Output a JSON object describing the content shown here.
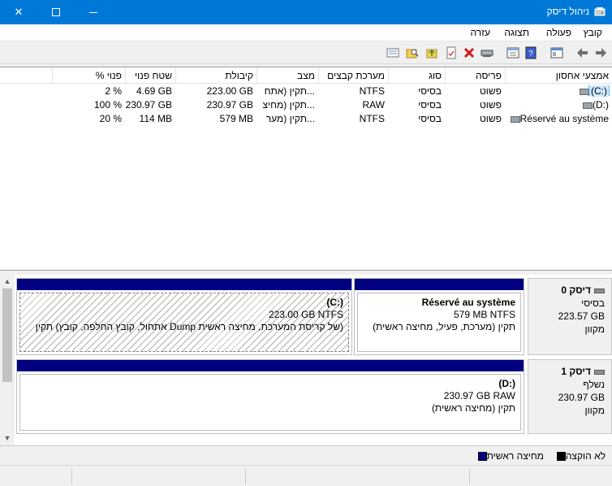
{
  "window": {
    "title": "ניהול דיסק",
    "close_glyph": "✕"
  },
  "menu": [
    "קובץ",
    "פעולה",
    "תצוגה",
    "עזרה"
  ],
  "volumes": {
    "columns": [
      "אמצעי אחסון",
      "פריסה",
      "סוג",
      "מערכת קבצים",
      "מצב",
      "קיבולת",
      "שטח פנוי",
      "% פנוי"
    ],
    "rows": [
      {
        "volume": "(C:)",
        "layout": "פשוט",
        "type": "בסיסי",
        "fs": "NTFS",
        "status": "תקין (אתח...",
        "capacity": "223.00 GB",
        "free": "4.69 GB",
        "pct": "2 %"
      },
      {
        "volume": "(D:)",
        "layout": "פשוט",
        "type": "בסיסי",
        "fs": "RAW",
        "status": "תקין (מחיצ...",
        "capacity": "230.97 GB",
        "free": "230.97 GB",
        "pct": "100 %"
      },
      {
        "volume": "Réservé au système",
        "layout": "פשוט",
        "type": "בסיסי",
        "fs": "NTFS",
        "status": "תקין (מער...",
        "capacity": "579 MB",
        "free": "114 MB",
        "pct": "20 %"
      }
    ]
  },
  "disks": [
    {
      "name": "דיסק 0",
      "type": "בסיסי",
      "size": "223.57 GB",
      "state": "מקוון",
      "partitions": [
        {
          "title": "Réservé au système",
          "detail": "579 MB NTFS",
          "status": "תקין (מערכת, פעיל, מחיצה ראשית)"
        },
        {
          "title": "(C:)",
          "detail": "223.00 GB NTFS",
          "status": "תקין (אתחול, קובץ החלפה, קובץ Dump של קריסת המערכת, מחיצה ראשית)"
        }
      ]
    },
    {
      "name": "דיסק 1",
      "type": "נשלף",
      "size": "230.97 GB",
      "state": "מקוון",
      "partitions": [
        {
          "title": "(D:)",
          "detail": "230.97 GB RAW",
          "status": "תקין (מחיצה ראשית)"
        }
      ]
    }
  ],
  "legend": {
    "unallocated": "לא הוקצה",
    "primary": "מחיצה ראשית",
    "unallocated_color": "#000000",
    "primary_color": "#000080"
  },
  "colors": {
    "titlebar": "#0078d7",
    "partition_bar": "#000080"
  }
}
